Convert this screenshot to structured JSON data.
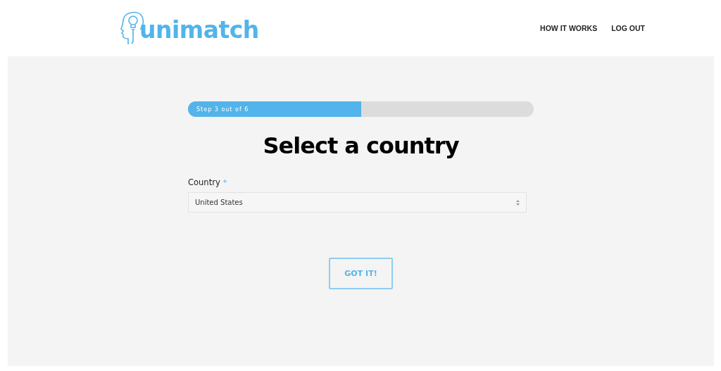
{
  "header": {
    "logo": "unimatch",
    "nav": [
      {
        "label": "HOW IT WORKS"
      },
      {
        "label": "LOG OUT"
      }
    ]
  },
  "progress": {
    "label": "Step 3 out of 6",
    "level": 0.5
  },
  "title": "Select a country",
  "field": {
    "label": "Country",
    "required_mark": "*",
    "value": "United States"
  },
  "button": "GOT IT!"
}
